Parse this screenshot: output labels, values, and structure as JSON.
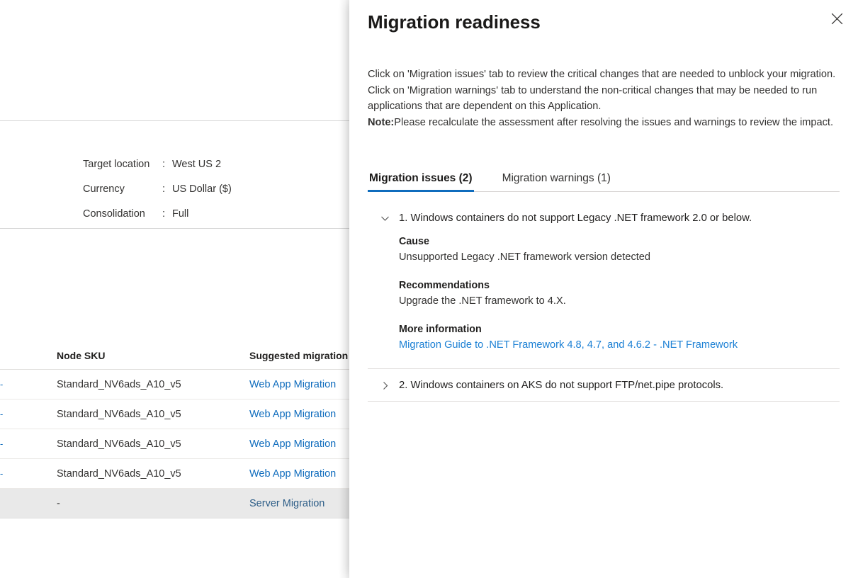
{
  "background": {
    "details": [
      {
        "label": "Target location",
        "colon": ":",
        "value": "West US 2"
      },
      {
        "label": "Currency",
        "colon": ":",
        "value": "US Dollar ($)"
      },
      {
        "label": "Consolidation",
        "colon": ":",
        "value": "Full"
      }
    ],
    "table": {
      "headers": {
        "stub": "",
        "node_sku": "Node SKU",
        "suggested": "Suggested migration"
      },
      "rows": [
        {
          "stub": "-",
          "node_sku": "Standard_NV6ads_A10_v5",
          "suggested": "Web App Migration",
          "selected": false
        },
        {
          "stub": "-",
          "node_sku": "Standard_NV6ads_A10_v5",
          "suggested": "Web App Migration",
          "selected": false
        },
        {
          "stub": "-",
          "node_sku": "Standard_NV6ads_A10_v5",
          "suggested": "Web App Migration",
          "selected": false
        },
        {
          "stub": "-",
          "node_sku": "Standard_NV6ads_A10_v5",
          "suggested": "Web App Migration",
          "selected": false
        },
        {
          "stub": "",
          "node_sku": "-",
          "suggested": "Server Migration",
          "selected": true
        }
      ]
    }
  },
  "panel": {
    "title": "Migration readiness",
    "close_icon": "close-icon",
    "description_part1": "Click on 'Migration issues' tab to review the critical changes that are needed to unblock your migration. Click on 'Migration warnings' tab to understand the non-critical changes that may be needed to run applications that are dependent on this Application.",
    "note_label": "Note:",
    "note_text": "Please recalculate the assessment after resolving the issues and warnings to review the impact.",
    "tabs": [
      {
        "label": "Migration issues (2)",
        "active": true
      },
      {
        "label": "Migration warnings (1)",
        "active": false
      }
    ],
    "issues": [
      {
        "index": "1.",
        "title": "1. Windows containers do not support Legacy .NET framework 2.0 or below.",
        "expanded": true,
        "chevron_icon": "chevron-down-icon",
        "cause_label": "Cause",
        "cause_value": "Unsupported Legacy .NET framework version detected",
        "recommendations_label": "Recommendations",
        "recommendations_value": "Upgrade the .NET framework to 4.X.",
        "more_info_label": "More information",
        "more_info_link": "Migration Guide to .NET Framework 4.8, 4.7, and 4.6.2 - .NET Framework"
      },
      {
        "index": "2.",
        "title": "2. Windows containers on AKS do not support FTP/net.pipe protocols.",
        "expanded": false,
        "chevron_icon": "chevron-right-icon"
      }
    ]
  },
  "colors": {
    "accent": "#0f6cbd",
    "link": "#1a7fd4",
    "selected_row": "#e9e9e9",
    "text": "#323130",
    "divider": "#e1dfdd"
  }
}
